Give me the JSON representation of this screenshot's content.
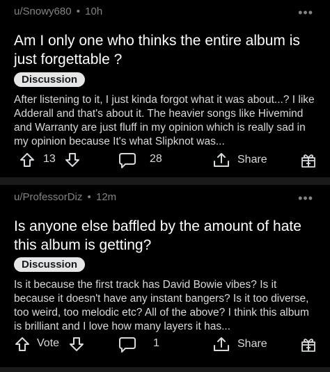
{
  "posts": [
    {
      "author": "u/Snowy680",
      "time": "10h",
      "title": "Am I only one who thinks the entire album is just forgettable ?",
      "flair": "Discussion",
      "body": "After listening to it, I just kinda forgot what it was about...? I like Adderall and that's about it. The heavier songs like Hivemind and Warranty are just fluff in my opinion which is really sad in my opinion because It's what Slipknot was...",
      "score": "13",
      "comments": "28",
      "share": "Share"
    },
    {
      "author": "u/ProfessorDiz",
      "time": "12m",
      "title": "Is anyone else baffled by the amount of hate this album is getting?",
      "flair": "Discussion",
      "body": "Is it because the first track has David Bowie vibes? Is it because it doesn't have any instant bangers? Is it too diverse, too weird, too melodic etc? All of the above? I think this album is brilliant and I love how many layers it has...",
      "score": "Vote",
      "comments": "1",
      "share": "Share"
    }
  ],
  "separator": "•",
  "more_icon": "more-horizontal-icon",
  "colors": {
    "background": "#000000",
    "flair_bg": "#e4e6e8",
    "meta": "#818384"
  }
}
